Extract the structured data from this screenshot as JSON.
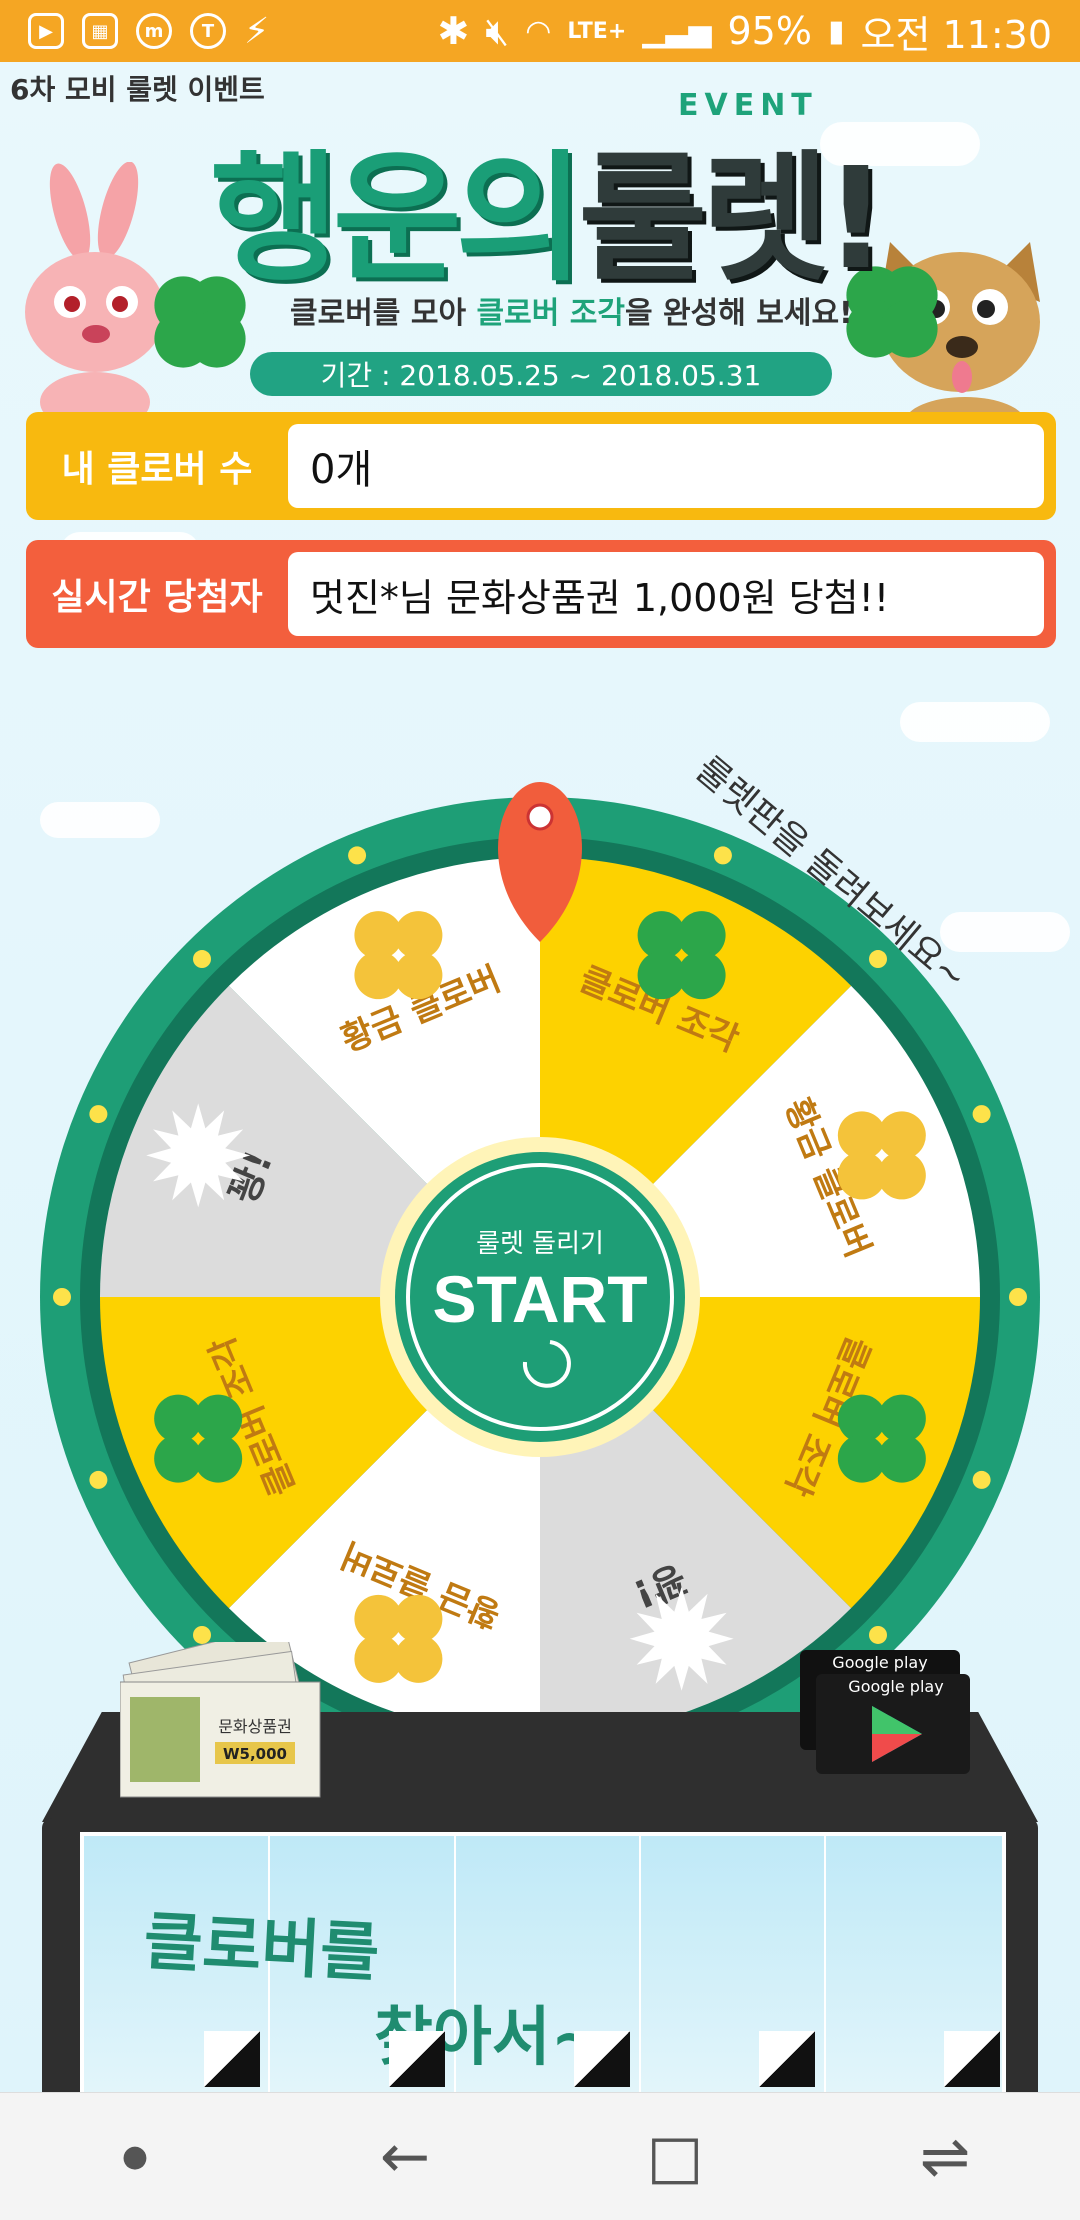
{
  "statusbar": {
    "battery": "95%",
    "network": "LTE+",
    "time": "오전 11:30"
  },
  "page": {
    "title": "6차 모비 룰렛 이벤트"
  },
  "banner": {
    "event_word": "EVENT",
    "title_green": "행운의",
    "title_dark": "룰렛!",
    "subtitle_prefix": "클로버를 모아 ",
    "subtitle_highlight": "클로버 조각",
    "subtitle_suffix": "을 완성해 보세요!",
    "period": "기간 : 2018.05.25 ~ 2018.05.31"
  },
  "my_clover": {
    "label": "내 클로버 수",
    "value": "0개"
  },
  "winners": {
    "label": "실시간 당첨자",
    "value": "멋진*님 문화상품권 1,000원 당첨!!"
  },
  "wheel": {
    "caption": "룰렛판을 돌려보세요~",
    "center_sub": "룰렛 돌리기",
    "center_main": "START",
    "segments": [
      {
        "label": "클로버 조각",
        "type": "piece"
      },
      {
        "label": "황금 클로버",
        "type": "gold"
      },
      {
        "label": "클로버 조각",
        "type": "piece"
      },
      {
        "label": "꽝!",
        "type": "miss"
      },
      {
        "label": "황금 클로버",
        "type": "gold"
      },
      {
        "label": "클로버 조각",
        "type": "piece"
      },
      {
        "label": "꽝!",
        "type": "miss"
      },
      {
        "label": "황금 클로버",
        "type": "gold"
      }
    ],
    "colors": {
      "ring": "#1e9e76",
      "piece": "#fdd200",
      "gold": "#ffffff",
      "miss": "#dcdcdc",
      "text": "#c07a12",
      "pointer": "#f15d3c"
    }
  },
  "gift_card": {
    "amount": "W5,000",
    "name": "문화상품권"
  },
  "google_play": {
    "label": "Google play"
  },
  "screen_panel": {
    "line1": "클로버를",
    "line2": "찾아서~"
  }
}
